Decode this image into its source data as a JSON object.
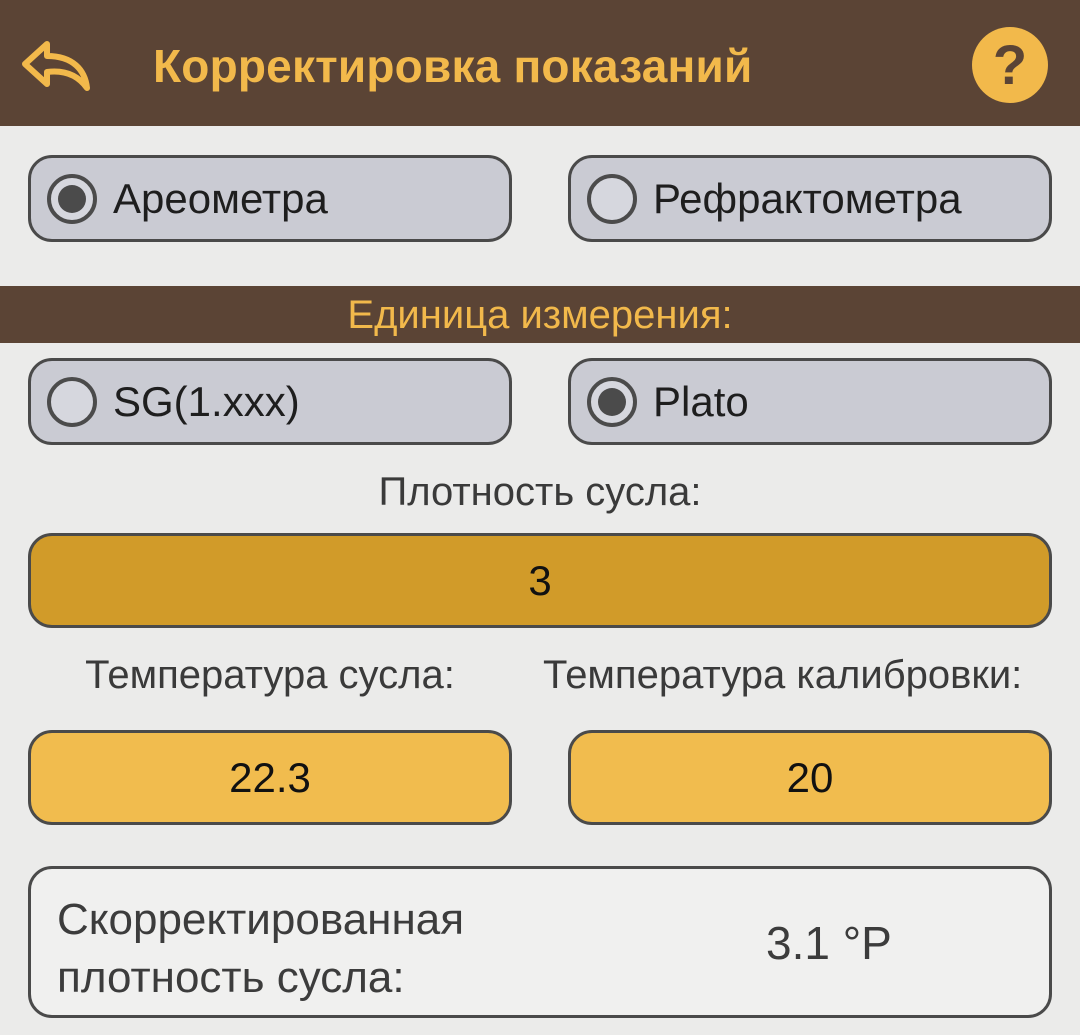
{
  "header": {
    "title": "Корректировка показаний",
    "back_icon": "back-arrow-icon",
    "help_icon": "help-icon",
    "help_glyph": "?",
    "colors": {
      "bar": "#5b4435",
      "accent": "#f2b94b"
    }
  },
  "instrument": {
    "options": [
      {
        "label": "Ареометра",
        "selected": true
      },
      {
        "label": "Рефрактометра",
        "selected": false
      }
    ]
  },
  "units": {
    "title": "Единица измерения:",
    "options": [
      {
        "label": "SG(1.xxx)",
        "selected": false
      },
      {
        "label": "Plato",
        "selected": true
      }
    ]
  },
  "gravity": {
    "label": "Плотность сусла:",
    "value": "3"
  },
  "wort_temp": {
    "label": "Температура сусла:",
    "value": "22.3"
  },
  "calibration_temp": {
    "label": "Температура калибровки:",
    "value": "20"
  },
  "result": {
    "label": "Скорректированная плотность сусла:",
    "value": "3.1 °P"
  }
}
